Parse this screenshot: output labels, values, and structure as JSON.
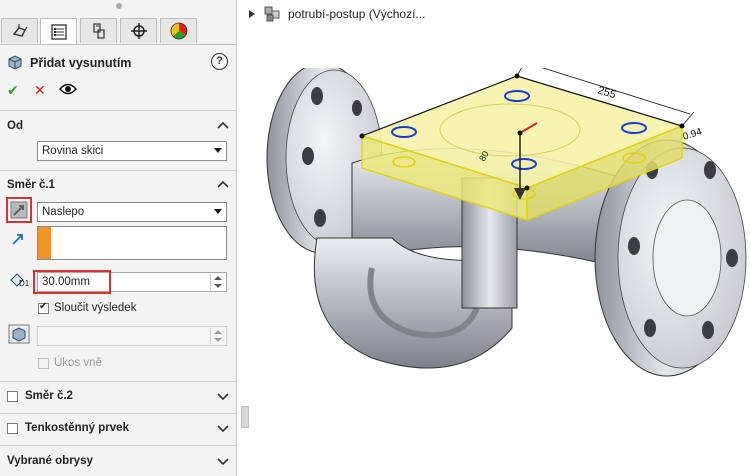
{
  "tabs": [
    {
      "name": "feature-manager",
      "icon": "feature-tree-icon"
    },
    {
      "name": "property-manager",
      "icon": "property-manager-icon"
    },
    {
      "name": "configuration-manager",
      "icon": "configuration-manager-icon"
    },
    {
      "name": "dimxpert-manager",
      "icon": "crosshair-icon"
    },
    {
      "name": "display-manager",
      "icon": "appearance-pie-icon"
    }
  ],
  "feature": {
    "title": "Přidat vysunutím",
    "help": "?"
  },
  "actions": {
    "ok": "✔",
    "cancel": "✕",
    "preview": "👁"
  },
  "from": {
    "header": "Od",
    "start_condition": "Rovina skici"
  },
  "direction1": {
    "header": "Směr č.1",
    "end_condition": "Naslepo",
    "depth_label": "D1",
    "depth": "30.00mm",
    "merge_result": "Sloučit výsledek",
    "merge_checked": true,
    "draft_outward": "Úkos vně",
    "draft_checked": false
  },
  "direction2": {
    "header": "Směr č.2",
    "checked": false
  },
  "thin_feature": {
    "header": "Tenkostěnný prvek",
    "checked": false
  },
  "selected_contours": {
    "header": "Vybrané obrysy"
  },
  "graphics": {
    "tree_title": "potrubí-postup  (Výchozí..."
  },
  "model": {
    "dims": [
      "255",
      "80",
      "0.94"
    ],
    "colors": {
      "preview": "#f1ee9a",
      "preview_edge": "#e6d400",
      "metal": "#b8bcc3",
      "hole": "#1a3bd6"
    }
  }
}
